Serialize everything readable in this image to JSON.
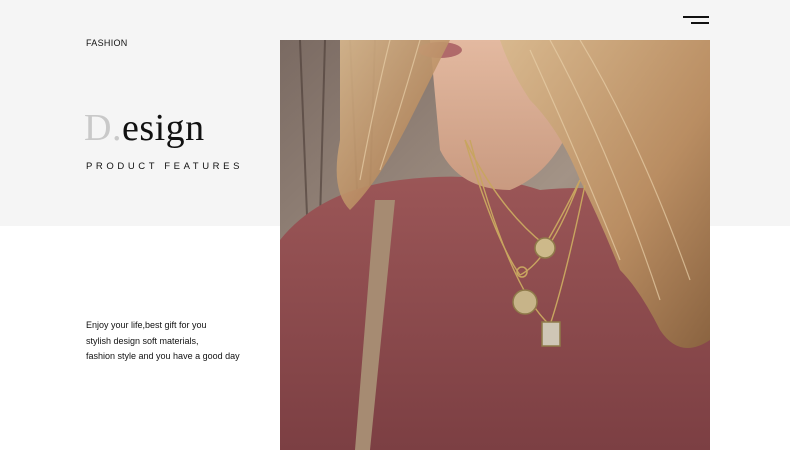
{
  "header": {
    "category": "FASHION",
    "menu_icon": "hamburger-menu-icon"
  },
  "hero": {
    "headline_initial": "D.",
    "headline_rest": "esign",
    "subtitle": "PRODUCT FEATURES"
  },
  "description": {
    "lines": [
      "Enjoy your life,best gift for you",
      "stylish design soft materials,",
      "fashion style and you have a good day"
    ]
  },
  "photo": {
    "subject": "woman-wearing-necklaces",
    "colors": {
      "sweater": "#8c4b4e",
      "hair": "#c9a57a",
      "background_trees": "#6b5a50",
      "pendant": "#c8b58a"
    }
  }
}
